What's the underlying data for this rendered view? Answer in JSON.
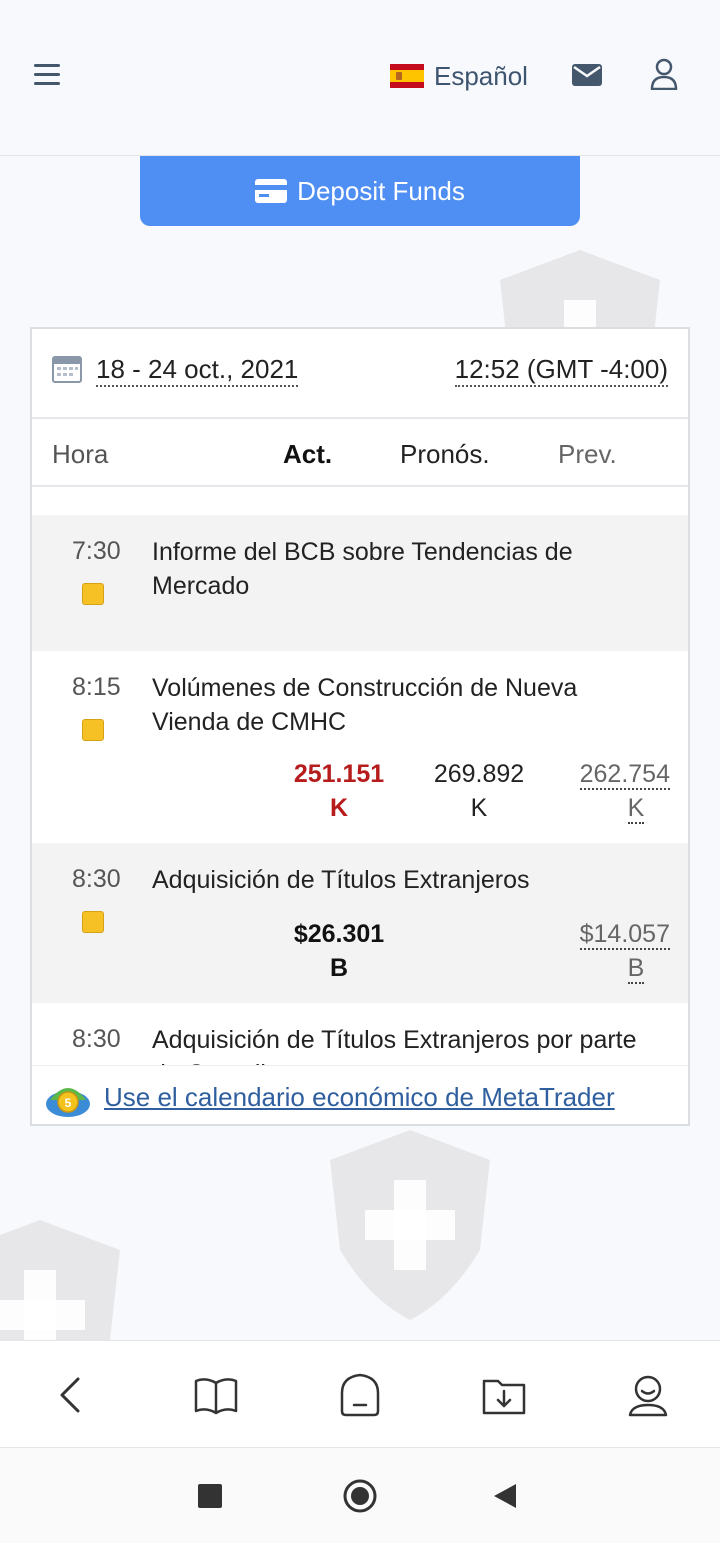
{
  "header": {
    "language_label": "Español",
    "deposit_label": "Deposit Funds"
  },
  "calendar": {
    "date_range": "18 - 24 oct., 2021",
    "time_zone": "12:52 (GMT -4:00)",
    "columns": {
      "hora": "Hora",
      "actual": "Act.",
      "forecast": "Pronós.",
      "previous": "Prev."
    },
    "events": [
      {
        "time": "7:30",
        "title": "Informe del BCB sobre Tendencias de Mercado",
        "actual": "",
        "actual_unit": "",
        "forecast": "",
        "forecast_unit": "",
        "previous": "",
        "previous_unit": "",
        "importance_color": "#f5c125"
      },
      {
        "time": "8:15",
        "title": "Volúmenes de Construcción de Nueva Vienda de CMHC",
        "actual": "251.151",
        "actual_unit": "K",
        "forecast": "269.892",
        "forecast_unit": "K",
        "previous": "262.754",
        "previous_unit": "K",
        "importance_color": "#f5c125"
      },
      {
        "time": "8:30",
        "title": "Adquisición de Títulos Extranjeros",
        "actual": "$26.301",
        "actual_unit": "B",
        "forecast": "",
        "forecast_unit": "",
        "previous": "$14.057",
        "previous_unit": "B",
        "importance_color": "#f5c125"
      },
      {
        "time": "8:30",
        "title": "Adquisición de Títulos Extranjeros por parte de Canadienses",
        "actual": "",
        "actual_unit": "",
        "forecast": "",
        "forecast_unit": "",
        "previous": "",
        "previous_unit": "",
        "importance_color": "#f5c125"
      }
    ],
    "metatrader_link": "Use el calendario económico de MetaTrader"
  },
  "colors": {
    "accent": "#4f8ef3",
    "actual_negative": "#b71c1c",
    "importance_medium": "#f5c125"
  },
  "icons": {
    "menu": "hamburger-icon",
    "mail": "mail-icon",
    "user": "user-icon",
    "card": "credit-card-icon",
    "calendar": "calendar-icon",
    "metatrader": "metatrader-icon"
  }
}
